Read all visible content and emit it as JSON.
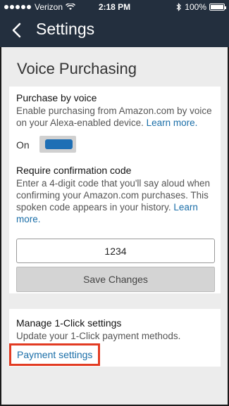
{
  "status": {
    "carrier": "Verizon",
    "time": "2:18 PM",
    "battery": "100%"
  },
  "nav": {
    "title": "Settings"
  },
  "page": {
    "heading": "Voice Purchasing"
  },
  "purchase_by_voice": {
    "label": "Purchase by voice",
    "desc": "Enable purchasing from Amazon.com by voice on your Alexa-enabled device. ",
    "learn_more": "Learn more.",
    "toggle_label": "On",
    "toggle_on": true
  },
  "confirmation": {
    "label": "Require confirmation code",
    "desc": "Enter a 4-digit code that you'll say aloud when confirming your Amazon.com purchases. This spoken code appears in your history. ",
    "learn_more": "Learn more.",
    "code_value": "1234",
    "save_label": "Save Changes"
  },
  "one_click": {
    "label": "Manage 1-Click settings",
    "desc": "Update your 1-Click payment methods.",
    "link": "Payment settings"
  },
  "colors": {
    "nav_bg": "#232f3e",
    "link": "#1a6ea8",
    "toggle_fill": "#1e6fb5",
    "highlight_border": "#e23b22"
  }
}
